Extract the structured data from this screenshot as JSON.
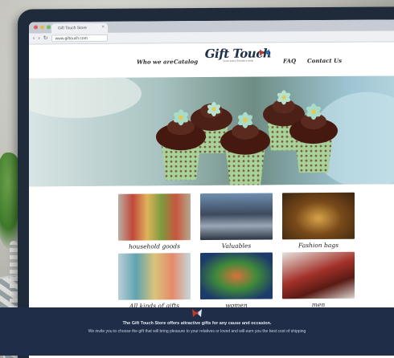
{
  "browser": {
    "tab_title": "Gift Touch Store",
    "url": "www.giftouch.com",
    "tab_close_glyph": "×",
    "back_glyph": "‹",
    "forward_glyph": "›",
    "reload_glyph": "↻"
  },
  "site": {
    "logo_text": "Gift Touch",
    "logo_tagline": "Touch every Gift with a smile",
    "nav": [
      {
        "label": "Who we are"
      },
      {
        "label": "Catalog"
      },
      {
        "label": "FAQ"
      },
      {
        "label": "Contact Us"
      }
    ]
  },
  "categories": [
    {
      "label": "household goods"
    },
    {
      "label": "Valuables"
    },
    {
      "label": "Fashion bags"
    },
    {
      "label": "All kinds of gifts"
    },
    {
      "label": "women"
    },
    {
      "label": "men"
    }
  ],
  "footer": {
    "line1": "The Gift Touch Store offers attractive gifts for any cause and occasion.",
    "line2": "We invite you to choose the gift that will bring pleasure to your relatives or loved and will earn you the best cost of shipping"
  },
  "colors": {
    "footer_bg": "#1f2d48",
    "logo": "#1f2f4a",
    "frosting": "#5a2a1e",
    "leaf": "#a9dcc8",
    "cup": "#9dc98e"
  },
  "icons": [
    "traffic-light-dots",
    "back-arrow-icon",
    "forward-arrow-icon",
    "reload-icon",
    "bow-icon",
    "ribbon-icon"
  ]
}
